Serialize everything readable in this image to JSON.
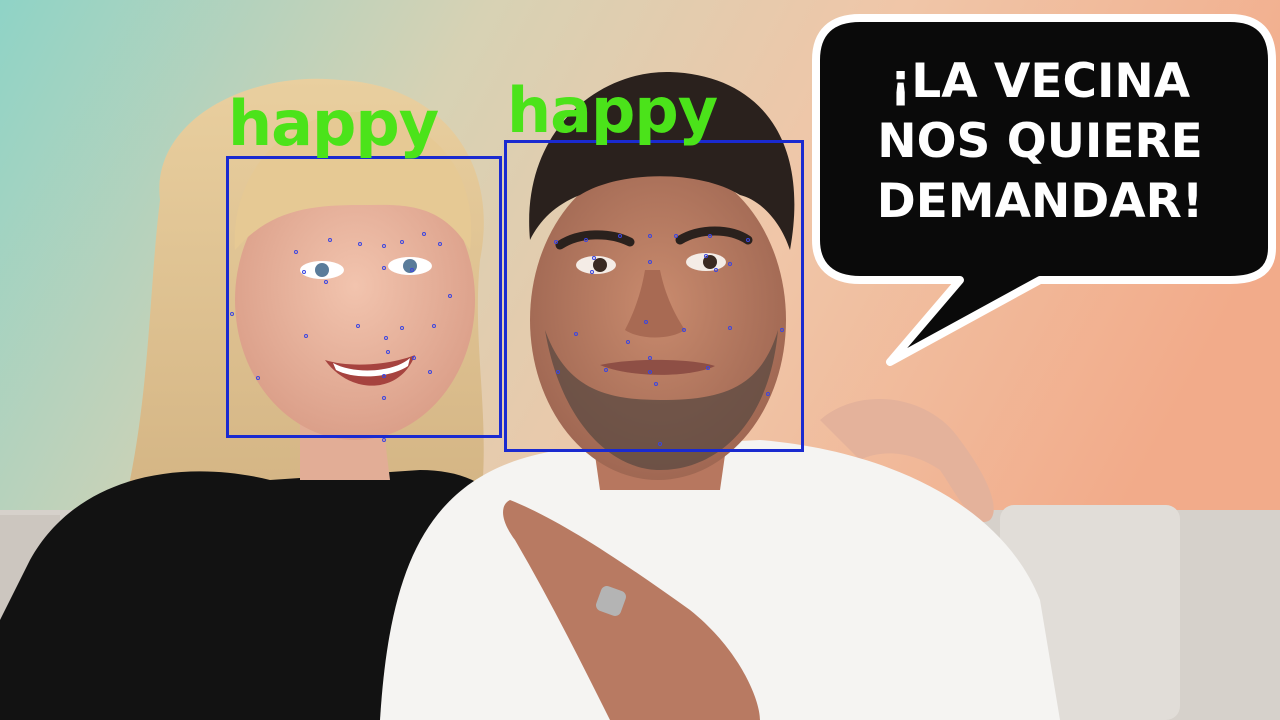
{
  "scene": {
    "description_icons": [
      "woman-figure",
      "man-figure",
      "speech-bubble"
    ],
    "colors": {
      "label": "#4be31a",
      "box": "#1a2ad0",
      "bubble_fill": "#0a0a0a",
      "bubble_stroke": "#ffffff",
      "bubble_text": "#ffffff"
    }
  },
  "detections": [
    {
      "label": "happy"
    },
    {
      "label": "happy"
    }
  ],
  "speech_bubble": {
    "text": "¡LA VECINA NOS QUIERE DEMANDAR!"
  }
}
